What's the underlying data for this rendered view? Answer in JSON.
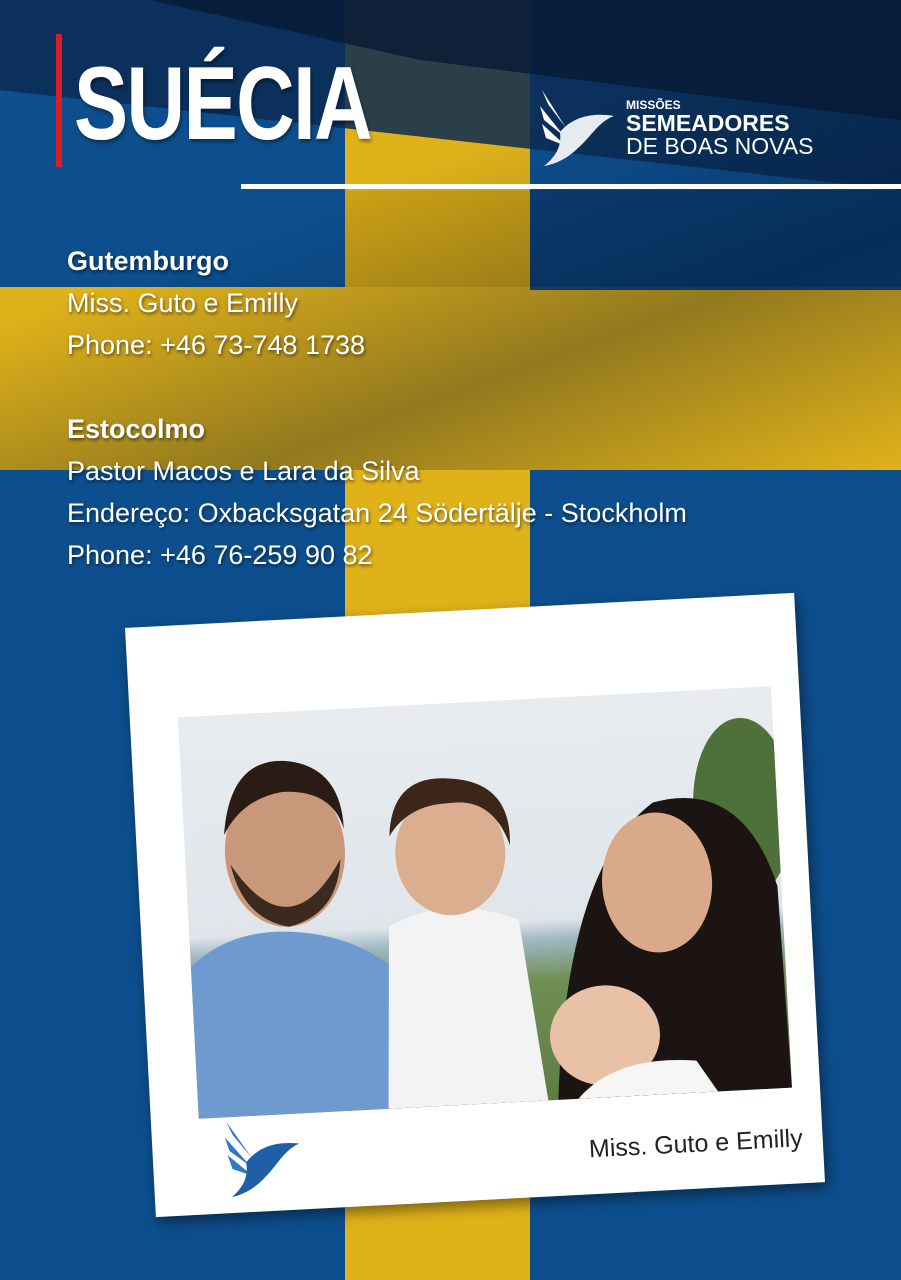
{
  "header": {
    "title": "SUÉCIA",
    "logo": {
      "line1": "MISSÕES",
      "line2": "SEMEADORES",
      "line3": "DE BOAS NOVAS"
    }
  },
  "contacts": [
    {
      "city": "Gutemburgo",
      "lines": [
        "Miss. Guto e Emilly",
        "Phone: +46 73-748 1738"
      ]
    },
    {
      "city": "Estocolmo",
      "lines": [
        "Pastor Macos e Lara da Silva",
        "Endereço: Oxbacksgatan 24 Södertälje - Stockholm",
        "Phone: +46 76-259 90 82"
      ]
    }
  ],
  "photo": {
    "caption": "Miss. Guto e Emilly"
  },
  "colors": {
    "blue": "#0d4f8e",
    "yellow": "#e0b21a",
    "red": "#d81f26"
  }
}
